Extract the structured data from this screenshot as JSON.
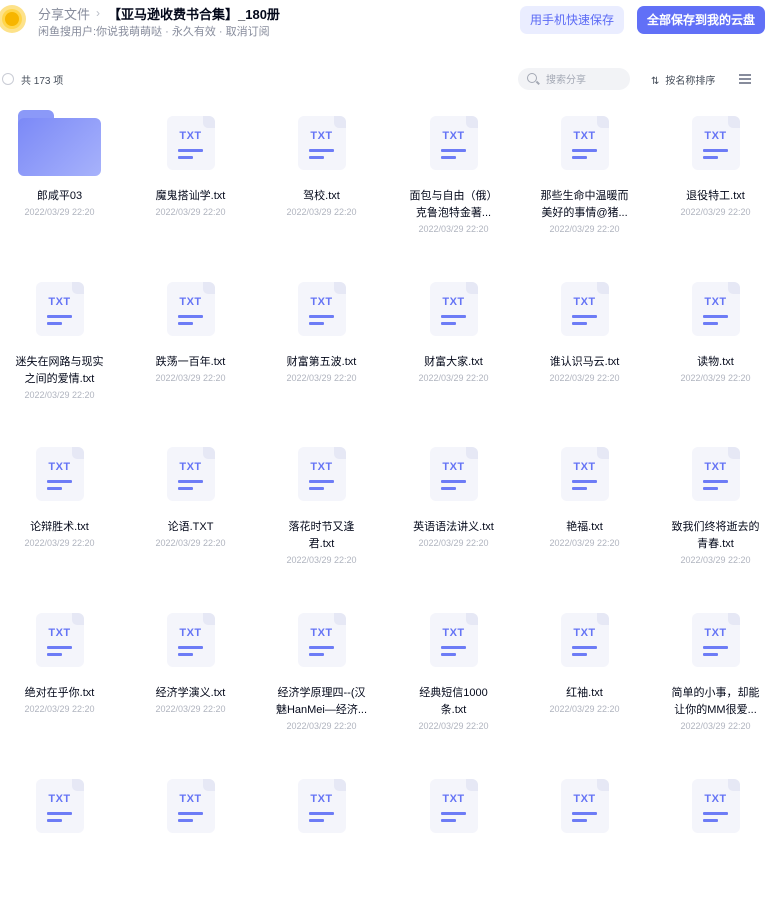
{
  "header": {
    "breadcrumb_root": "分享文件",
    "breadcrumb_sep": "›",
    "title": "【亚马逊收费书合集】_180册",
    "sharer": "闲鱼搜用户:你说我萌萌哒 · 永久有效 · 取消订阅",
    "phone_save_label": "用手机快速保存",
    "save_all_label": "全部保存到我的云盘"
  },
  "toolbar": {
    "count": "共 173 项",
    "search_placeholder": "搜索分享",
    "sort_icon": "⇅",
    "sort_label": "按名称排序"
  },
  "colors": {
    "accent": "#6170f7",
    "accent_light": "#eaedff"
  },
  "files": [
    {
      "name": [
        "郎咸平03"
      ],
      "date": "2022/03/29 22:20",
      "type": "folder"
    },
    {
      "name": [
        "魔鬼搭讪学.txt"
      ],
      "date": "2022/03/29 22:20",
      "type": "txt"
    },
    {
      "name": [
        "驾校.txt"
      ],
      "date": "2022/03/29 22:20",
      "type": "txt"
    },
    {
      "name": [
        "面包与自由（俄）",
        "克鲁泡特金著..."
      ],
      "date": "2022/03/29 22:20",
      "type": "txt"
    },
    {
      "name": [
        "那些生命中温暖而",
        "美好的事情@猪..."
      ],
      "date": "2022/03/29 22:20",
      "type": "txt"
    },
    {
      "name": [
        "退役特工.txt"
      ],
      "date": "2022/03/29 22:20",
      "type": "txt"
    },
    {
      "name": [
        "迷失在网路与现实",
        "之间的爱情.txt"
      ],
      "date": "2022/03/29 22:20",
      "type": "txt"
    },
    {
      "name": [
        "跌荡一百年.txt"
      ],
      "date": "2022/03/29 22:20",
      "type": "txt"
    },
    {
      "name": [
        "财富第五波.txt"
      ],
      "date": "2022/03/29 22:20",
      "type": "txt"
    },
    {
      "name": [
        "财富大家.txt"
      ],
      "date": "2022/03/29 22:20",
      "type": "txt"
    },
    {
      "name": [
        "谁认识马云.txt"
      ],
      "date": "2022/03/29 22:20",
      "type": "txt"
    },
    {
      "name": [
        "读物.txt"
      ],
      "date": "2022/03/29 22:20",
      "type": "txt"
    },
    {
      "name": [
        "论辩胜术.txt"
      ],
      "date": "2022/03/29 22:20",
      "type": "txt"
    },
    {
      "name": [
        "论语.TXT"
      ],
      "date": "2022/03/29 22:20",
      "type": "txt"
    },
    {
      "name": [
        "落花时节又逢",
        "君.txt"
      ],
      "date": "2022/03/29 22:20",
      "type": "txt"
    },
    {
      "name": [
        "英语语法讲义.txt"
      ],
      "date": "2022/03/29 22:20",
      "type": "txt"
    },
    {
      "name": [
        "艳福.txt"
      ],
      "date": "2022/03/29 22:20",
      "type": "txt"
    },
    {
      "name": [
        "致我们终将逝去的",
        "青春.txt"
      ],
      "date": "2022/03/29 22:20",
      "type": "txt"
    },
    {
      "name": [
        "绝对在乎你.txt"
      ],
      "date": "2022/03/29 22:20",
      "type": "txt"
    },
    {
      "name": [
        "经济学演义.txt"
      ],
      "date": "2022/03/29 22:20",
      "type": "txt"
    },
    {
      "name": [
        "经济学原理四--(汉",
        "魅HanMei—经济..."
      ],
      "date": "2022/03/29 22:20",
      "type": "txt"
    },
    {
      "name": [
        "经典短信1000",
        "条.txt"
      ],
      "date": "2022/03/29 22:20",
      "type": "txt"
    },
    {
      "name": [
        "红袖.txt"
      ],
      "date": "2022/03/29 22:20",
      "type": "txt"
    },
    {
      "name": [
        "简单的小事，却能",
        "让你的MM很爱..."
      ],
      "date": "2022/03/29 22:20",
      "type": "txt"
    },
    {
      "name": [],
      "date": "",
      "type": "txt"
    },
    {
      "name": [],
      "date": "",
      "type": "txt"
    },
    {
      "name": [],
      "date": "",
      "type": "txt"
    },
    {
      "name": [],
      "date": "",
      "type": "txt"
    },
    {
      "name": [],
      "date": "",
      "type": "txt"
    },
    {
      "name": [],
      "date": "",
      "type": "txt"
    }
  ],
  "txt_icon_label": "TXT"
}
